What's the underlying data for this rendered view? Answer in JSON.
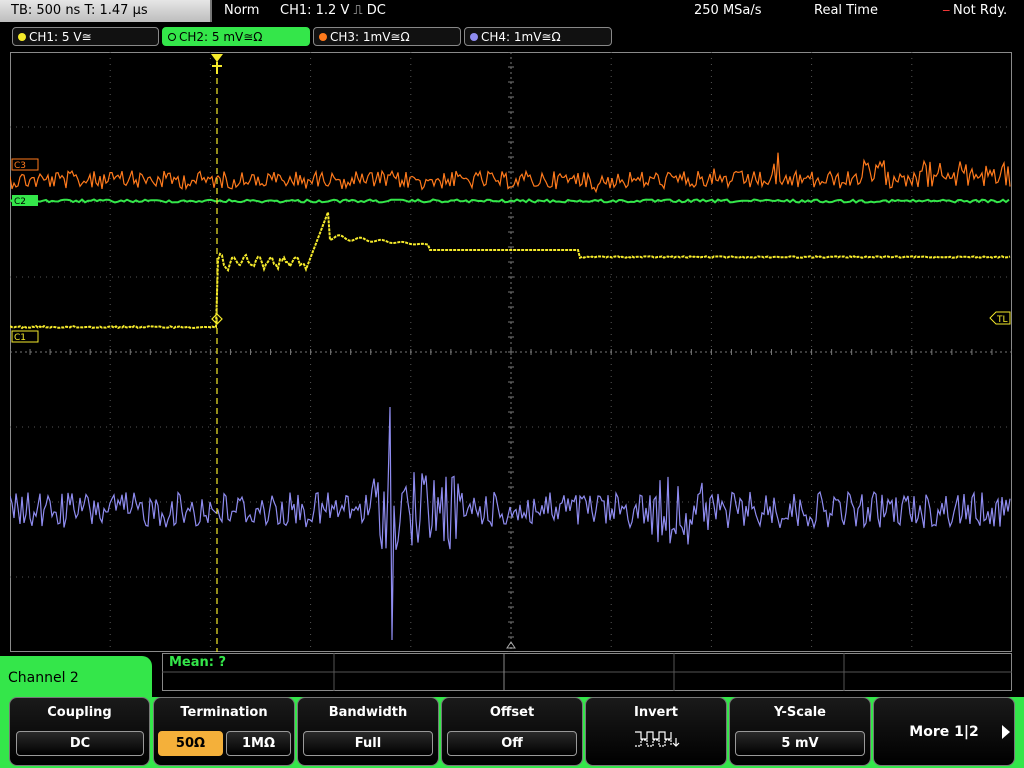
{
  "status": {
    "timebase": "TB: 500 ns   T: 1.47 μs",
    "trigger_mode": "Norm",
    "trigger_info": "CH1: 1.2 V ⎍ DC",
    "sample_rate": "250 MSa/s",
    "acq_mode": "Real Time",
    "ready_state": "Not Rdy."
  },
  "channels": [
    {
      "label": "CH1: 5 V≅",
      "color": "#f5ea2b"
    },
    {
      "label": "CH2: 5 mV≅Ω",
      "color": "#34e64a"
    },
    {
      "label": "CH3: 1mV≅Ω",
      "color": "#ff7a1c"
    },
    {
      "label": "CH4: 1mV≅Ω",
      "color": "#8f8cf0"
    }
  ],
  "markers": {
    "c3": "C3",
    "c2": "C2",
    "c1": "C1",
    "tl": "TL",
    "trigger": "T"
  },
  "info": {
    "mean": "Mean: ?"
  },
  "panel": {
    "title": "Channel 2"
  },
  "softkeys": {
    "coupling": {
      "title": "Coupling",
      "value": "DC"
    },
    "termination": {
      "title": "Termination",
      "opt1": "50Ω",
      "opt2": "1MΩ"
    },
    "bandwidth": {
      "title": "Bandwidth",
      "value": "Full"
    },
    "offset": {
      "title": "Offset",
      "value": "Off"
    },
    "invert": {
      "title": "Invert",
      "icon": "inverted-square-wave-icon"
    },
    "yscale": {
      "title": "Y-Scale",
      "value": "5 mV"
    },
    "more": {
      "label": "More 1|2",
      "icon": "right-arrow-icon"
    }
  },
  "colors": {
    "ch1": "#f5ea2b",
    "ch2": "#34e64a",
    "ch3": "#ff7a1c",
    "ch4": "#8f8cf0",
    "softkey_bar": "#34e64a",
    "selected_option": "#f4b03a"
  }
}
